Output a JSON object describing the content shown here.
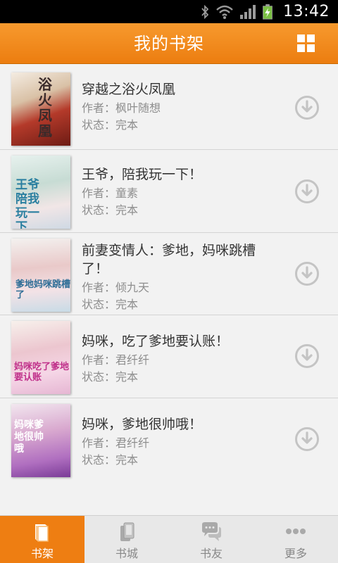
{
  "status_bar": {
    "time": "13:42",
    "icons": [
      "bluetooth-icon",
      "wifi-icon",
      "signal-icon",
      "battery-charging-icon"
    ]
  },
  "header": {
    "title": "我的书架",
    "grid_icon": "grid-view-icon"
  },
  "books": [
    {
      "title": "穿越之浴火凤凰",
      "author": "作者：枫叶随想",
      "status": "状态：完本",
      "cover_text": "浴火凤凰"
    },
    {
      "title": "王爷，陪我玩一下！",
      "author": "作者：童素",
      "status": "状态：完本",
      "cover_text": "王爷陪我玩一下"
    },
    {
      "title": "前妻变情人：爹地，妈咪跳槽了！",
      "author": "作者：倾九天",
      "status": "状态：完本",
      "cover_text": "爹地妈咪跳槽了"
    },
    {
      "title": "妈咪，吃了爹地要认账！",
      "author": "作者：君纤纤",
      "status": "状态：完本",
      "cover_text": "妈咪吃了爹地要认账"
    },
    {
      "title": "妈咪，爹地很帅哦！",
      "author": "作者：君纤纤",
      "status": "状态：完本",
      "cover_text": "妈咪爹地很帅哦"
    }
  ],
  "bottom_nav": [
    {
      "label": "书架",
      "icon": "bookshelf-icon",
      "active": true
    },
    {
      "label": "书城",
      "icon": "bookstore-icon",
      "active": false
    },
    {
      "label": "书友",
      "icon": "chat-bubbles-icon",
      "active": false
    },
    {
      "label": "更多",
      "icon": "more-dots-icon",
      "active": false
    }
  ],
  "colors": {
    "accent": "#ee7e12",
    "background": "#f2f2f2",
    "title_text": "#333333",
    "meta_text": "#8e8e8e"
  }
}
